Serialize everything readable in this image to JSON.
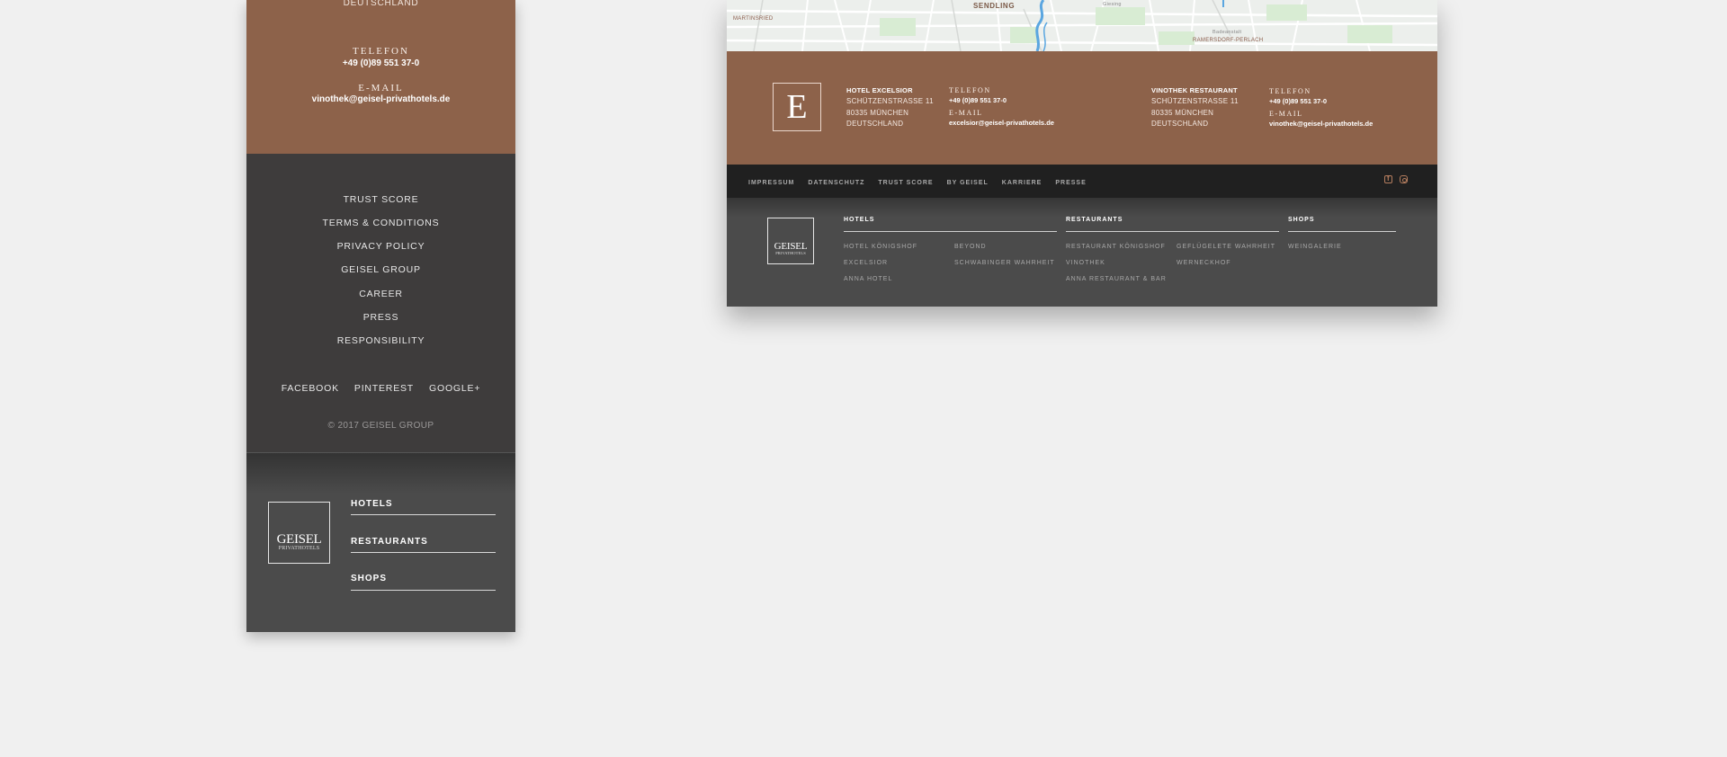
{
  "mobile": {
    "contact": {
      "country": "DEUTSCHLAND",
      "phone_label": "TELEFON",
      "phone": "+49 (0)89 551 37-0",
      "email_label": "E-MAIL",
      "email": "vinothek@geisel-privathotels.de"
    },
    "links": [
      "TRUST SCORE",
      "TERMS & CONDITIONS",
      "PRIVACY POLICY",
      "GEISEL GROUP",
      "CAREER",
      "PRESS",
      "RESPONSIBILITY"
    ],
    "social": [
      "FACEBOOK",
      "PINTEREST",
      "GOOGLE+"
    ],
    "copyright": "© 2017 GEISEL GROUP",
    "logo": {
      "line1": "GEISEL",
      "line2": "PRIVATHOTELS"
    },
    "categories": [
      "HOTELS",
      "RESTAURANTS",
      "SHOPS"
    ]
  },
  "desktop": {
    "map_labels": {
      "sendling": "SENDLING",
      "martinsried": "MARTINSRIED",
      "giesing": "Giesing",
      "ramersdorf": "RAMERSDORF-PERLACH",
      "badeanstalt": "Badeanstalt"
    },
    "monogram": "E",
    "hotel": {
      "name": "HOTEL EXCELSIOR",
      "address": [
        "SCHÜTZENSTRASSE 11",
        "80335 MÜNCHEN",
        "DEUTSCHLAND"
      ],
      "phone_label": "TELEFON",
      "phone": "+49 (0)89 551 37-0",
      "email_label": "E-MAIL",
      "email": "excelsior@geisel-privathotels.de"
    },
    "restaurant": {
      "name": "VINOTHEK RESTAURANT",
      "address": [
        "SCHÜTZENSTRASSE 11",
        "80335 MÜNCHEN",
        "DEUTSCHLAND"
      ],
      "phone_label": "TELEFON",
      "phone": "+49 (0)89 551 37-0",
      "email_label": "E-MAIL",
      "email": "vinothek@geisel-privathotels.de"
    },
    "nav": [
      "IMPRESSUM",
      "DATENSCHUTZ",
      "TRUST SCORE",
      "BY GEISEL",
      "KARRIERE",
      "PRESSE"
    ],
    "social_icons": [
      "facebook-icon",
      "instagram-icon"
    ],
    "accent_color": "#b47d5e",
    "logo": {
      "line1": "GEISEL",
      "line2": "PRIVATHOTELS"
    },
    "groups": {
      "hotels": {
        "title": "HOTELS",
        "col1": [
          "HOTEL KÖNIGSHOF",
          "EXCELSIOR",
          "ANNA HOTEL"
        ],
        "col2": [
          "BEYOND",
          "SCHWABINGER WAHRHEIT"
        ]
      },
      "restaurants": {
        "title": "RESTAURANTS",
        "col1": [
          "RESTAURANT KÖNIGSHOF",
          "VINOTHEK",
          "ANNA RESTAURANT & BAR"
        ],
        "col2": [
          "GEFLÜGELETE WAHRHEIT",
          "WERNECKHOF"
        ]
      },
      "shops": {
        "title": "SHOPS",
        "col1": [
          "WEINGALERIE"
        ]
      }
    }
  }
}
